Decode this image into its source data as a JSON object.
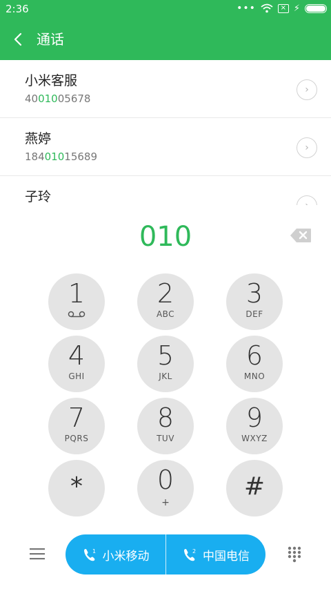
{
  "status_bar": {
    "time": "2:36",
    "dots": "•••",
    "sim": "×",
    "charging": "⚡"
  },
  "header": {
    "title": "通话"
  },
  "contacts": [
    {
      "name": "小米客服",
      "number_before": "40",
      "number_match": "010",
      "number_after": "05678"
    },
    {
      "name": "燕婷",
      "number_before": "184",
      "number_match": "010",
      "number_after": "15689"
    },
    {
      "name": "子玲",
      "number_before": "",
      "number_match": "",
      "number_after": ""
    }
  ],
  "arrow_glyph": "›",
  "dialed_number": "010",
  "keypad": [
    {
      "digit": "1",
      "letters": ""
    },
    {
      "digit": "2",
      "letters": "ABC"
    },
    {
      "digit": "3",
      "letters": "DEF"
    },
    {
      "digit": "4",
      "letters": "GHI"
    },
    {
      "digit": "5",
      "letters": "JKL"
    },
    {
      "digit": "6",
      "letters": "MNO"
    },
    {
      "digit": "7",
      "letters": "PQRS"
    },
    {
      "digit": "8",
      "letters": "TUV"
    },
    {
      "digit": "9",
      "letters": "WXYZ"
    },
    {
      "digit": "*",
      "letters": ""
    },
    {
      "digit": "0",
      "letters": "+"
    },
    {
      "digit": "#",
      "letters": ""
    }
  ],
  "call_buttons": [
    {
      "label": "小米移动",
      "sim": "1"
    },
    {
      "label": "中国电信",
      "sim": "2"
    }
  ],
  "colors": {
    "accent_green": "#2fb95a",
    "call_blue": "#19aef0",
    "key_gray": "#e4e4e4"
  }
}
